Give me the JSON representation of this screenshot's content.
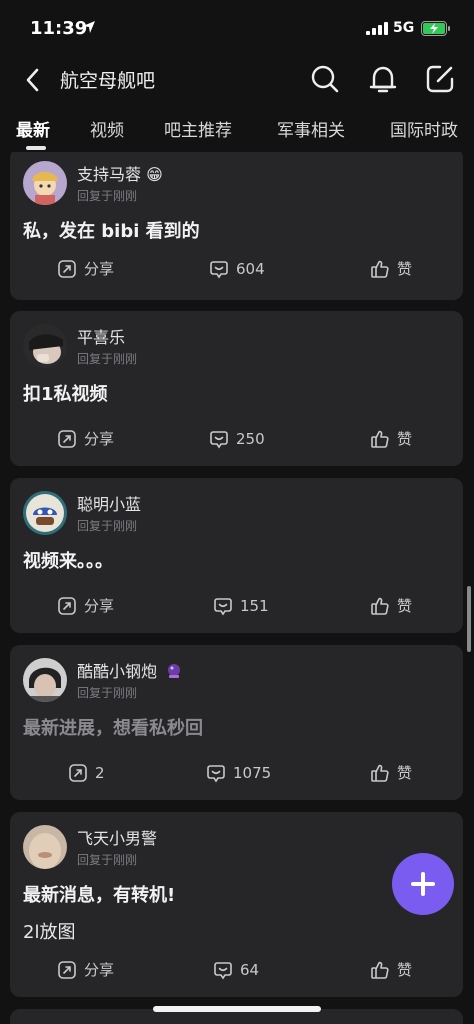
{
  "status_bar": {
    "time": "11:39",
    "network": "5G"
  },
  "header": {
    "title": "航空母舰吧"
  },
  "tabs": [
    {
      "label": "最新",
      "active": true
    },
    {
      "label": "视频"
    },
    {
      "label": "吧主推荐"
    },
    {
      "label": "军事相关"
    },
    {
      "label": "国际时政"
    }
  ],
  "posts": [
    {
      "user": "支持马蓉",
      "emoji": "😁",
      "reply": "回复于刚刚",
      "text": "私，发在 bibi 看到的",
      "share": "分享",
      "comments": "604",
      "like": "赞"
    },
    {
      "user": "平喜乐",
      "reply": "回复于刚刚",
      "text": "扣1私视频",
      "share": "分享",
      "comments": "250",
      "like": "赞"
    },
    {
      "user": "聪明小蓝",
      "reply": "回复于刚刚",
      "text": "视频来。。。",
      "share": "分享",
      "comments": "151",
      "like": "赞"
    },
    {
      "user": "酷酷小钢炮",
      "reply": "回复于刚刚",
      "text": "最新进展，想看私秒回",
      "share": "2",
      "comments": "1075",
      "like": "赞"
    },
    {
      "user": "飞天小男警",
      "reply": "回复于刚刚",
      "text": "最新消息，有转机!",
      "text2": "2l放图",
      "share": "分享",
      "comments": "64",
      "like": "赞"
    }
  ],
  "colors": {
    "accent": "#7a5cf0",
    "card": "#262629",
    "background": "#121212"
  }
}
